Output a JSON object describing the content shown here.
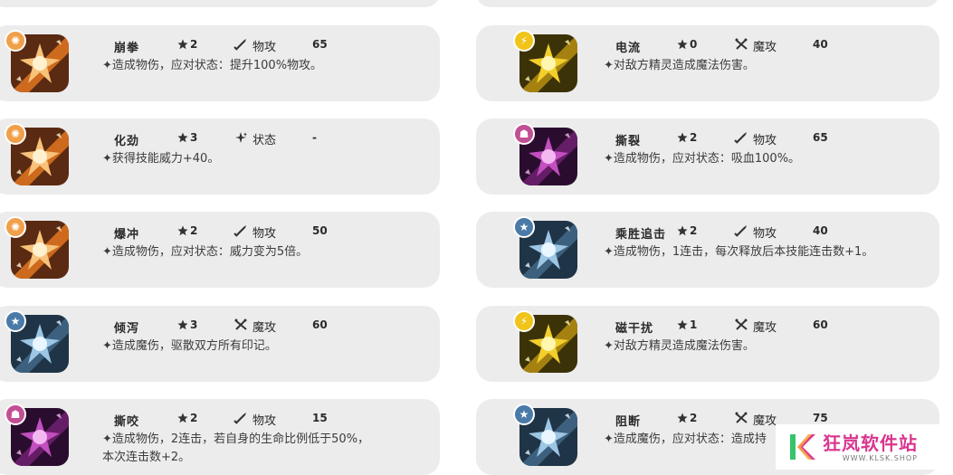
{
  "skills": [
    {
      "name": "崩拳",
      "cost": "2",
      "type": "物攻",
      "power": "65",
      "desc": "✦造成物伤，应对状态：提升100%物攻。",
      "badge": "fire",
      "art": "orange"
    },
    {
      "name": "电流",
      "cost": "0",
      "type": "魔攻",
      "power": "40",
      "desc": "✦对敌方精灵造成魔法伤害。",
      "badge": "bolt",
      "art": "yellow"
    },
    {
      "name": "化劲",
      "cost": "3",
      "type": "状态",
      "power": "-",
      "desc": "✦获得技能威力+40。",
      "badge": "fire",
      "art": "orange"
    },
    {
      "name": "撕裂",
      "cost": "2",
      "type": "物攻",
      "power": "65",
      "desc": "✦造成物伤，应对状态：吸血100%。",
      "badge": "demon",
      "art": "purple"
    },
    {
      "name": "爆冲",
      "cost": "2",
      "type": "物攻",
      "power": "50",
      "desc": "✦造成物伤，应对状态：威力变为5倍。",
      "badge": "fire",
      "art": "orange"
    },
    {
      "name": "乘胜追击",
      "cost": "2",
      "type": "物攻",
      "power": "40",
      "desc": "✦造成物伤，1连击，每次释放后本技能连击数+1。",
      "badge": "star",
      "art": "blue"
    },
    {
      "name": "倾泻",
      "cost": "3",
      "type": "魔攻",
      "power": "60",
      "desc": "✦造成魔伤，驱散双方所有印记。",
      "badge": "star",
      "art": "blue"
    },
    {
      "name": "磁干扰",
      "cost": "1",
      "type": "魔攻",
      "power": "60",
      "desc": "✦对敌方精灵造成魔法伤害。",
      "badge": "bolt",
      "art": "yellow"
    },
    {
      "name": "撕咬",
      "cost": "2",
      "type": "物攻",
      "power": "15",
      "desc": "✦造成物伤，2连击，若自身的生命比例低于50%，本次连击数+2。",
      "badge": "demon",
      "art": "purple"
    },
    {
      "name": "阻断",
      "cost": "2",
      "type": "魔攻",
      "power": "75",
      "desc": "✦造成魔伤，应对状态：造成持",
      "badge": "star",
      "art": "blue"
    }
  ],
  "colors": {
    "card_bg": "#ececec",
    "orange": "#f0a04a",
    "yellow": "#f0c419",
    "purple": "#c24f94",
    "blue": "#4a7aa8"
  },
  "watermark": {
    "title": "狂岚软件站",
    "url": "WWW.KLSK.SHOP"
  }
}
